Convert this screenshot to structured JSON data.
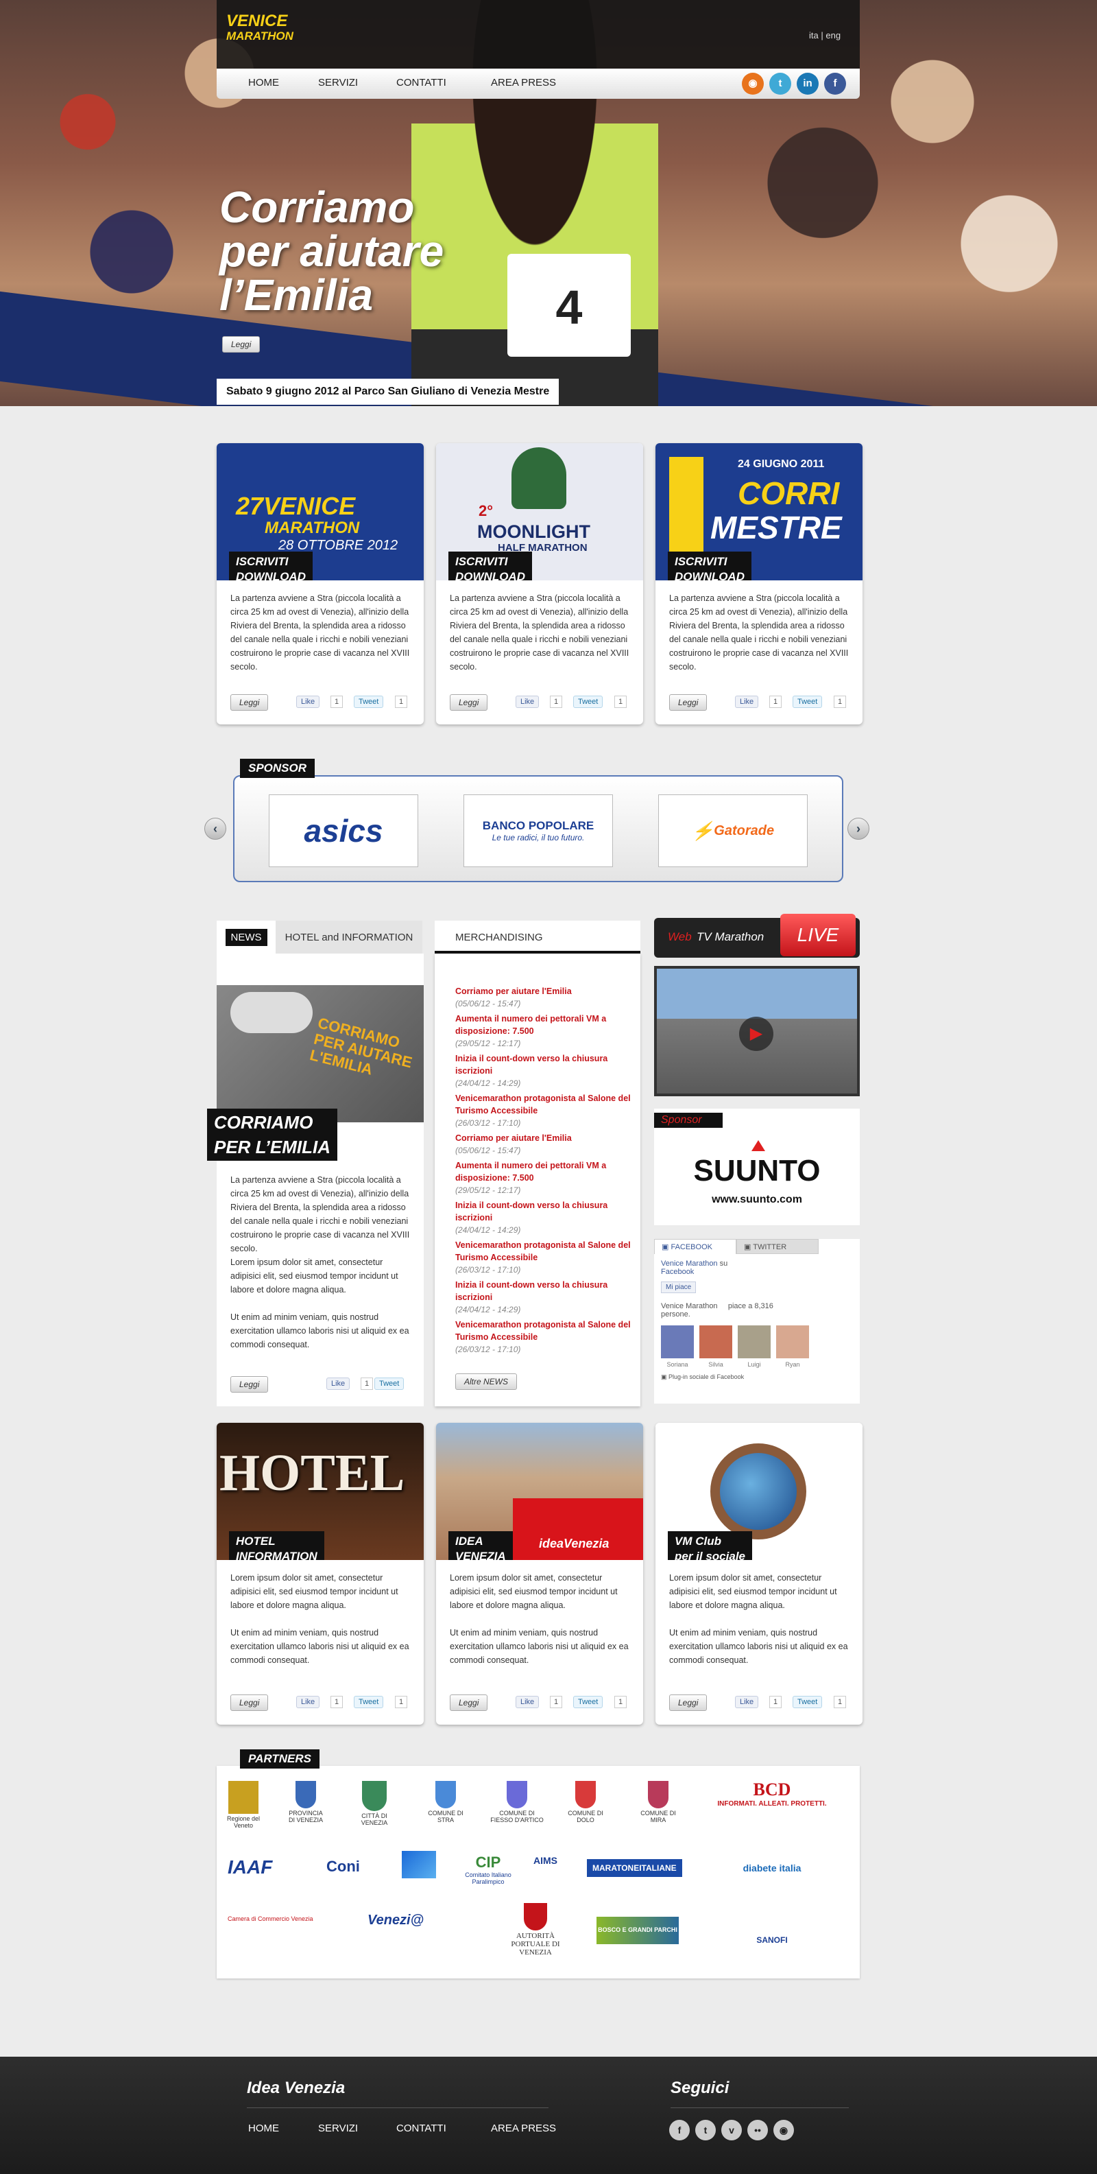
{
  "header": {
    "logo": {
      "line1": "VENICE",
      "line2": "MARATHON"
    },
    "lang": {
      "ita": "ita",
      "sep": "|",
      "eng": "eng"
    },
    "nav": [
      "HOME",
      "SERVIZI",
      "CONTATTI",
      "AREA PRESS"
    ],
    "social_icons": [
      "rss-icon",
      "twitter-icon",
      "linkedin-icon",
      "facebook-icon"
    ]
  },
  "hero": {
    "title_lines": [
      "Corriamo",
      "per aiutare",
      "l’Emilia"
    ],
    "read_button": "Leggi",
    "date_caption": "Sabato 9 giugno 2012 al Parco San Giuliano di Venezia Mestre",
    "bib_number": "4"
  },
  "events": [
    {
      "img_lines": [
        "27VENICE",
        "MARATHON",
        "28 OTTOBRE 2012"
      ],
      "tag": [
        "ISCRIVITI",
        "DOWNLOAD"
      ],
      "text": "La partenza avviene a Stra (piccola località a circa 25 km ad ovest di Venezia), all'inizio della Riviera del Brenta, la splendida area a ridosso del canale nella quale i ricchi e nobili veneziani costruirono le proprie case di vacanza nel XVIII secolo.",
      "read": "Leggi",
      "like": "Like",
      "like_count": "1",
      "tweet": "Tweet",
      "tweet_count": "1"
    },
    {
      "img_lines": [
        "2°",
        "MOONLIGHT",
        "HALF MARATHON"
      ],
      "tag": [
        "ISCRIVITI",
        "DOWNLOAD"
      ],
      "text": "La partenza avviene a Stra (piccola località a circa 25 km ad ovest di Venezia), all'inizio della Riviera del Brenta, la splendida area a ridosso del canale nella quale i ricchi e nobili veneziani costruirono le proprie case di vacanza nel XVIII secolo.",
      "read": "Leggi",
      "like": "Like",
      "like_count": "1",
      "tweet": "Tweet",
      "tweet_count": "1"
    },
    {
      "img_lines": [
        "24 GIUGNO 2011",
        "CORRI",
        "MESTRE"
      ],
      "tag": [
        "ISCRIVITI",
        "DOWNLOAD"
      ],
      "text": "La partenza avviene a Stra (piccola località a circa 25 km ad ovest di Venezia), all'inizio della Riviera del Brenta, la splendida area a ridosso del canale nella quale i ricchi e nobili veneziani costruirono le proprie case di vacanza nel XVIII secolo.",
      "read": "Leggi",
      "like": "Like",
      "like_count": "1",
      "tweet": "Tweet",
      "tweet_count": "1"
    }
  ],
  "sponsor": {
    "label": "SPONSOR",
    "logos": [
      {
        "name": "asics",
        "text": "asics",
        "color": "#1c3f94"
      },
      {
        "name": "banco-popolare",
        "text": "BANCO POPOLARE",
        "sub": "Le tue radici, il tuo futuro.",
        "color": "#1c3f94"
      },
      {
        "name": "gatorade",
        "text": "Gatorade",
        "color": "#f26a1b"
      }
    ]
  },
  "news": {
    "tabs": [
      "NEWS",
      "HOTEL and INFORMATION",
      "MERCHANDISING"
    ],
    "feature_title": [
      "CORRIAMO",
      "PER L’EMILIA"
    ],
    "feature_img_text": [
      "CORRIAMO",
      "PER AIUTARE",
      "L'EMILIA"
    ],
    "feature_text": "La partenza avviene a Stra (piccola località a circa 25 km ad ovest di Venezia), all'inizio della Riviera del Brenta, la splendida area a ridosso del canale nella quale i ricchi e nobili veneziani costruirono le proprie case di vacanza nel XVIII secolo.",
    "feature_text2": "Lorem ipsum dolor sit amet, consectetur adipisici elit, sed eiusmod tempor incidunt ut labore et dolore magna aliqua.",
    "feature_text3": "Ut enim ad minim veniam, quis nostrud exercitation ullamco laboris nisi ut aliquid ex ea commodi consequat.",
    "read": "Leggi",
    "like": "Like",
    "like_count": "1",
    "tweet": "Tweet",
    "tweet_count": "1",
    "items": [
      {
        "title": "Corriamo per aiutare l'Emilia",
        "date": "(05/06/12 - 15:47)"
      },
      {
        "title": "Aumenta il numero dei pettorali VM a disposizione: 7.500",
        "date": "(29/05/12 - 12:17)"
      },
      {
        "title": "Inizia il count-down verso la chiusura iscrizioni",
        "date": "(24/04/12 - 14:29)"
      },
      {
        "title": "Venicemarathon protagonista al Salone del Turismo Accessibile",
        "date": "(26/03/12 - 17:10)"
      },
      {
        "title": "Corriamo per aiutare l'Emilia",
        "date": "(05/06/12 - 15:47)"
      },
      {
        "title": "Aumenta il numero dei pettorali VM a disposizione: 7.500",
        "date": "(29/05/12 - 12:17)"
      },
      {
        "title": "Inizia il count-down verso la chiusura iscrizioni",
        "date": "(24/04/12 - 14:29)"
      },
      {
        "title": "Venicemarathon protagonista al Salone del Turismo Accessibile",
        "date": "(26/03/12 - 17:10)"
      },
      {
        "title": "Inizia il count-down verso la chiusura iscrizioni",
        "date": "(24/04/12 - 14:29)"
      },
      {
        "title": "Venicemarathon protagonista al Salone del Turismo Accessibile",
        "date": "(26/03/12 - 17:10)"
      }
    ],
    "more": "Altre NEWS"
  },
  "webtv": {
    "web": "Web",
    "rest": "TV Marathon",
    "live": "LIVE"
  },
  "side_sponsor": {
    "label": "Sponsor",
    "brand": "SUUNTO",
    "url": "www.suunto.com"
  },
  "social_box": {
    "tabs": [
      "FACEBOOK",
      "TWITTER"
    ],
    "page": "Venice Marathon",
    "on": "su",
    "network": "Facebook",
    "like_button": "Mi piace",
    "line": "Venice Marathon",
    "likes": "piace a 8,316",
    "people": "persone.",
    "friends": [
      "Soriana",
      "Silvia",
      "Luigi",
      "Ryan"
    ],
    "plugin": "Plug-in sociale di Facebook"
  },
  "info_cards": [
    {
      "img_text": "HOTEL",
      "tag": [
        "HOTEL",
        "INFORMATION"
      ],
      "text1": "Lorem ipsum dolor sit amet, consectetur adipisici elit, sed eiusmod tempor incidunt ut labore et dolore magna aliqua.",
      "text2": "Ut enim ad minim veniam, quis nostrud exercitation ullamco laboris nisi ut aliquid ex ea commodi consequat.",
      "read": "Leggi",
      "like": "Like",
      "like_count": "1",
      "tweet": "Tweet",
      "tweet_count": "1"
    },
    {
      "img_text": "ideaVenezia",
      "tag": [
        "IDEA",
        "VENEZIA"
      ],
      "text1": "Lorem ipsum dolor sit amet, consectetur adipisici elit, sed eiusmod tempor incidunt ut labore et dolore magna aliqua.",
      "text2": "Ut enim ad minim veniam, quis nostrud exercitation ullamco laboris nisi ut aliquid ex ea commodi consequat.",
      "read": "Leggi",
      "like": "Like",
      "like_count": "1",
      "tweet": "Tweet",
      "tweet_count": "1"
    },
    {
      "img_text": "",
      "tag": [
        "VM Club",
        "per il sociale"
      ],
      "text1": "Lorem ipsum dolor sit amet, consectetur adipisici elit, sed eiusmod tempor incidunt ut labore et dolore magna aliqua.",
      "text2": "Ut enim ad minim veniam, quis nostrud exercitation ullamco laboris nisi ut aliquid ex ea commodi consequat.",
      "read": "Leggi",
      "like": "Like",
      "like_count": "1",
      "tweet": "Tweet",
      "tweet_count": "1"
    }
  ],
  "partners": {
    "label": "PARTNERS",
    "row1": [
      "Regione del Veneto",
      "PROVINCIA DI VENEZIA",
      "CITTÀ DI VENEZIA",
      "COMUNE DI STRA",
      "COMUNE DI FIESSO D'ARTICO",
      "COMUNE DI DOLO",
      "COMUNE DI MIRA"
    ],
    "row2": [
      "IAAF",
      "Coni",
      "",
      "Comitato Italiano Paralimpico",
      "AIMS",
      "MARATONEITALIANE"
    ],
    "row3": [
      "Camera di Commercio Venezia",
      "Venezi@",
      "AUTORITÀ PORTUALE DI VENEZIA",
      "BOSCO E GRANDI PARCHI"
    ],
    "bcd": {
      "title": "BCD",
      "sub": "INFORMATI. ALLEATI. PROTETTI.",
      "sanofi": "SANOFI",
      "diabete": "diabete italia"
    }
  },
  "footer": {
    "left_title": "Idea Venezia",
    "nav": [
      "HOME",
      "SERVIZI",
      "CONTATTI",
      "AREA PRESS"
    ],
    "right_title": "Seguici",
    "social": [
      "facebook-icon",
      "twitter-icon",
      "vimeo-icon",
      "flickr-icon",
      "rss-icon"
    ]
  }
}
